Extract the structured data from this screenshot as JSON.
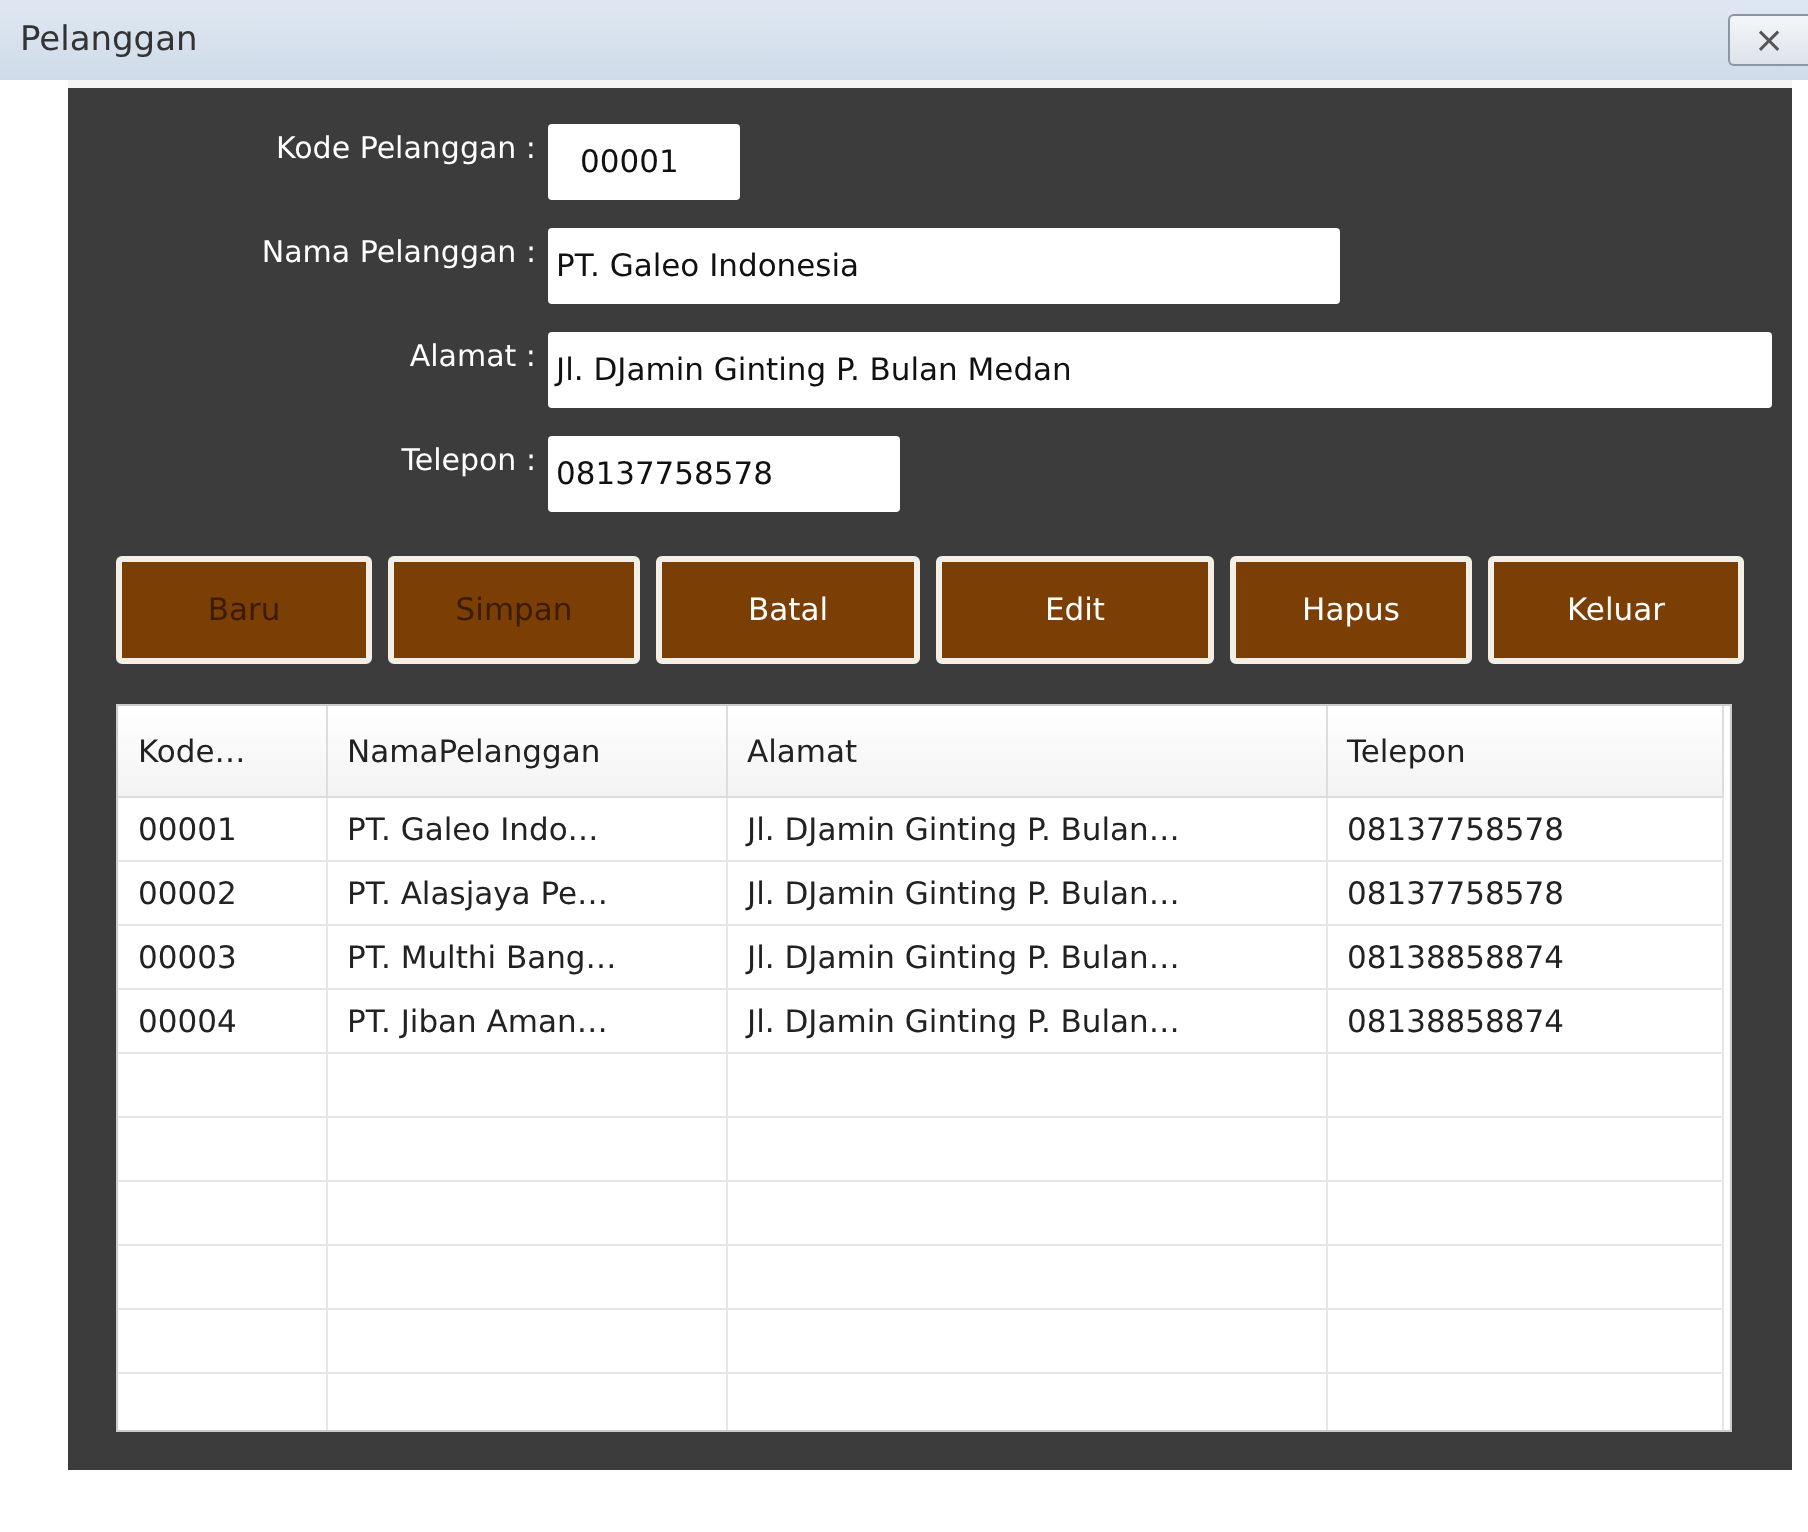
{
  "window": {
    "title": "Pelanggan",
    "close": "⨯"
  },
  "fields": [
    {
      "label": "Kode Pelanggan :",
      "value": "00001",
      "kind": "short"
    },
    {
      "label": "Nama Pelanggan :",
      "value": "PT. Galeo Indonesia",
      "kind": "medium"
    },
    {
      "label": "Alamat :",
      "value": "Jl. DJamin Ginting P. Bulan Medan",
      "kind": "long"
    },
    {
      "label": "Telepon :",
      "value": "08137758578",
      "kind": "phone"
    }
  ],
  "buttons": [
    {
      "label": "Baru",
      "disabled": true
    },
    {
      "label": "Simpan",
      "disabled": true
    },
    {
      "label": "Batal",
      "disabled": false
    },
    {
      "label": "Edit",
      "disabled": false
    },
    {
      "label": "Hapus",
      "disabled": false
    },
    {
      "label": "Keluar",
      "disabled": false
    }
  ],
  "table": {
    "columns": [
      "Kode…",
      "NamaPelanggan",
      "Alamat",
      "Telepon"
    ],
    "rows": [
      [
        "00001",
        "PT. Galeo Indo…",
        "Jl. DJamin Ginting P. Bulan…",
        "08137758578"
      ],
      [
        "00002",
        "PT. Alasjaya Pe…",
        "Jl. DJamin Ginting P. Bulan…",
        "08137758578"
      ],
      [
        "00003",
        "PT. Multhi Bang…",
        "Jl. DJamin Ginting P. Bulan…",
        "08138858874"
      ],
      [
        "00004",
        "PT. Jiban Aman…",
        "Jl. DJamin Ginting P. Bulan…",
        "08138858874"
      ]
    ]
  }
}
